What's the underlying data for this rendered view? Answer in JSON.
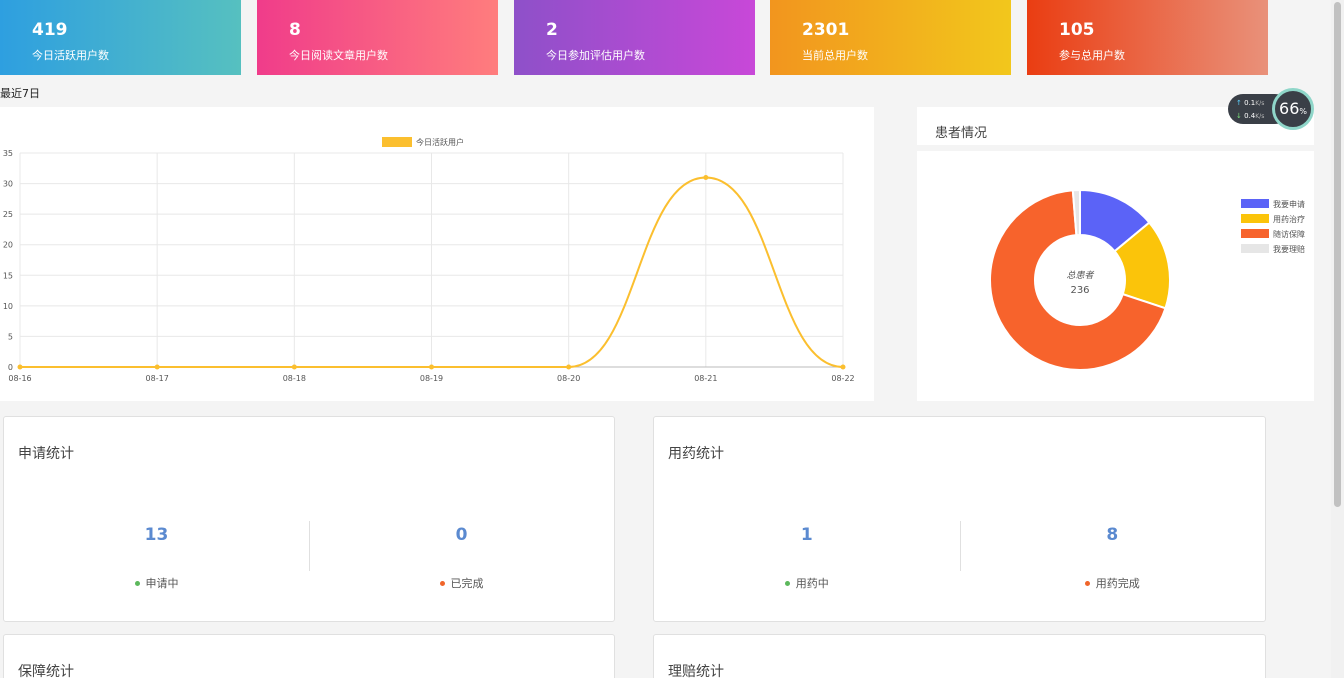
{
  "stat_cards": [
    {
      "value": "419",
      "label": "今日活跃用户数",
      "color_from": "#2e9fe0",
      "color_to": "#56c0c0"
    },
    {
      "value": "8",
      "label": "今日阅读文章用户数",
      "color_from": "#f03c8a",
      "color_to": "#ff7d7d"
    },
    {
      "value": "2",
      "label": "今日参加评估用户数",
      "color_from": "#8e50c9",
      "color_to": "#c848d8"
    },
    {
      "value": "2301",
      "label": "当前总用户数",
      "color_from": "#f2951e",
      "color_to": "#f2c71c"
    },
    {
      "value": "105",
      "label": "参与总用户数",
      "color_from": "#ea3d12",
      "color_to": "#e9917a"
    }
  ],
  "recent_label": "最近7日",
  "network": {
    "up": "0.1",
    "down": "0.4",
    "unit": "K/s",
    "percent": "66",
    "percent_sign": "%"
  },
  "pie_title": "患者情况",
  "stats": [
    {
      "title": "申请统计",
      "left_value": "13",
      "left_label": "申请中",
      "right_value": "0",
      "right_label": "已完成"
    },
    {
      "title": "用药统计",
      "left_value": "1",
      "left_label": "用药中",
      "right_value": "8",
      "right_label": "用药完成"
    },
    {
      "title": "保障统计"
    },
    {
      "title": "理赔统计"
    }
  ],
  "colors": {
    "green_dot": "#5cb85c",
    "orange_dot": "#f0652a",
    "line": "#fbbf2f"
  },
  "chart_data": [
    {
      "type": "line",
      "x": [
        "08-16",
        "08-17",
        "08-18",
        "08-19",
        "08-20",
        "08-21",
        "08-22"
      ],
      "series": [
        {
          "name": "今日活跃用户",
          "values": [
            0,
            0,
            0,
            0,
            0,
            31,
            0
          ],
          "color": "#fbbf2f"
        }
      ],
      "ylim": [
        0,
        35
      ],
      "yticks": [
        0,
        5,
        10,
        15,
        20,
        25,
        30,
        35
      ],
      "smooth": true,
      "grid": true,
      "legend": "top-center"
    },
    {
      "type": "pie",
      "donut": true,
      "center_label": "总患者",
      "center_value": "236",
      "legend": "right",
      "slices": [
        {
          "name": "我要申请",
          "value": 33,
          "color": "#5b63f7"
        },
        {
          "name": "用药治疗",
          "value": 38,
          "color": "#fbc40a"
        },
        {
          "name": "随访保障",
          "value": 162,
          "color": "#f7632c"
        },
        {
          "name": "我要理赔",
          "value": 3,
          "color": "#e6e6e6"
        }
      ]
    }
  ]
}
